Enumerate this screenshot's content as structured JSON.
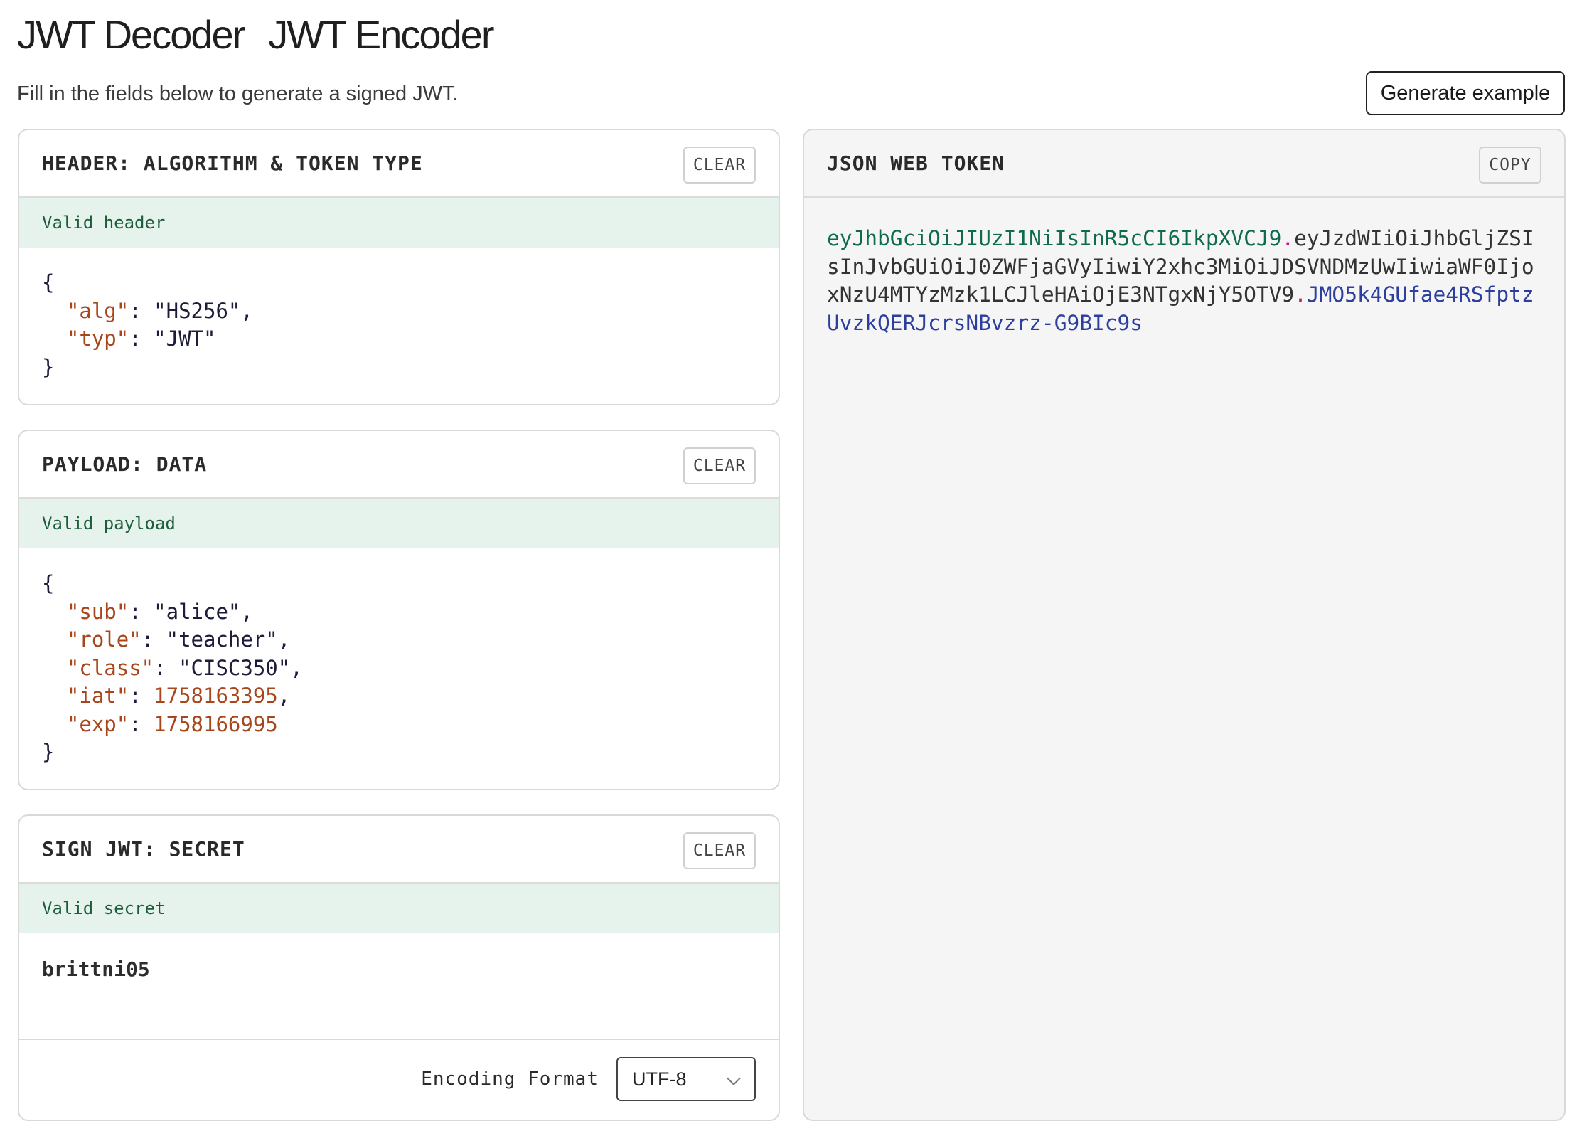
{
  "tabs": [
    "JWT Decoder",
    "JWT Encoder"
  ],
  "subtitle": "Fill in the fields below to generate a signed JWT.",
  "generate_button": "Generate example",
  "header_panel": {
    "title": "HEADER: ALGORITHM & TOKEN TYPE",
    "clear_label": "CLEAR",
    "status": "Valid header",
    "lines": {
      "open": "{",
      "alg_key": "\"alg\"",
      "alg_val": "\"HS256\"",
      "typ_key": "\"typ\"",
      "typ_val": "\"JWT\"",
      "close": "}"
    }
  },
  "payload_panel": {
    "title": "PAYLOAD: DATA",
    "clear_label": "CLEAR",
    "status": "Valid payload",
    "lines": {
      "open": "{",
      "sub_key": "\"sub\"",
      "sub_val": "\"alice\"",
      "role_key": "\"role\"",
      "role_val": "\"teacher\"",
      "class_key": "\"class\"",
      "class_val": "\"CISC350\"",
      "iat_key": "\"iat\"",
      "iat_val": "1758163395",
      "exp_key": "\"exp\"",
      "exp_val": "1758166995",
      "close": "}"
    }
  },
  "secret_panel": {
    "title": "SIGN JWT: SECRET",
    "clear_label": "CLEAR",
    "status": "Valid secret",
    "secret": "brittni05",
    "encoding_label": "Encoding Format",
    "encoding_value": "UTF-8"
  },
  "token_panel": {
    "title": "JSON WEB TOKEN",
    "copy_label": "COPY",
    "token_header": "eyJhbGciOiJIUzI1NiIsInR5cCI6IkpXVCJ9",
    "token_payload": "eyJzdWIiOiJhbGljZSIsInJvbGUiOiJ0ZWFjaGVyIiwiY2xhc3MiOiJDSVNDMzUwIiwiaWF0IjoxNzU4MTYzMzk1LCJleHAiOjE3NTgxNjY5OTV9",
    "token_signature": "JMO5k4GUfae4RSfptzUvzkQERJcrsNBvzrz-G9BIc9s",
    "separator": "."
  },
  "colors": {
    "token_header": "#0f6b4f",
    "token_payload": "#333333",
    "token_signature": "#2c3f9e",
    "separator": "#c2187a",
    "json_key": "#a8461b",
    "valid_bg": "#e6f3ec"
  }
}
